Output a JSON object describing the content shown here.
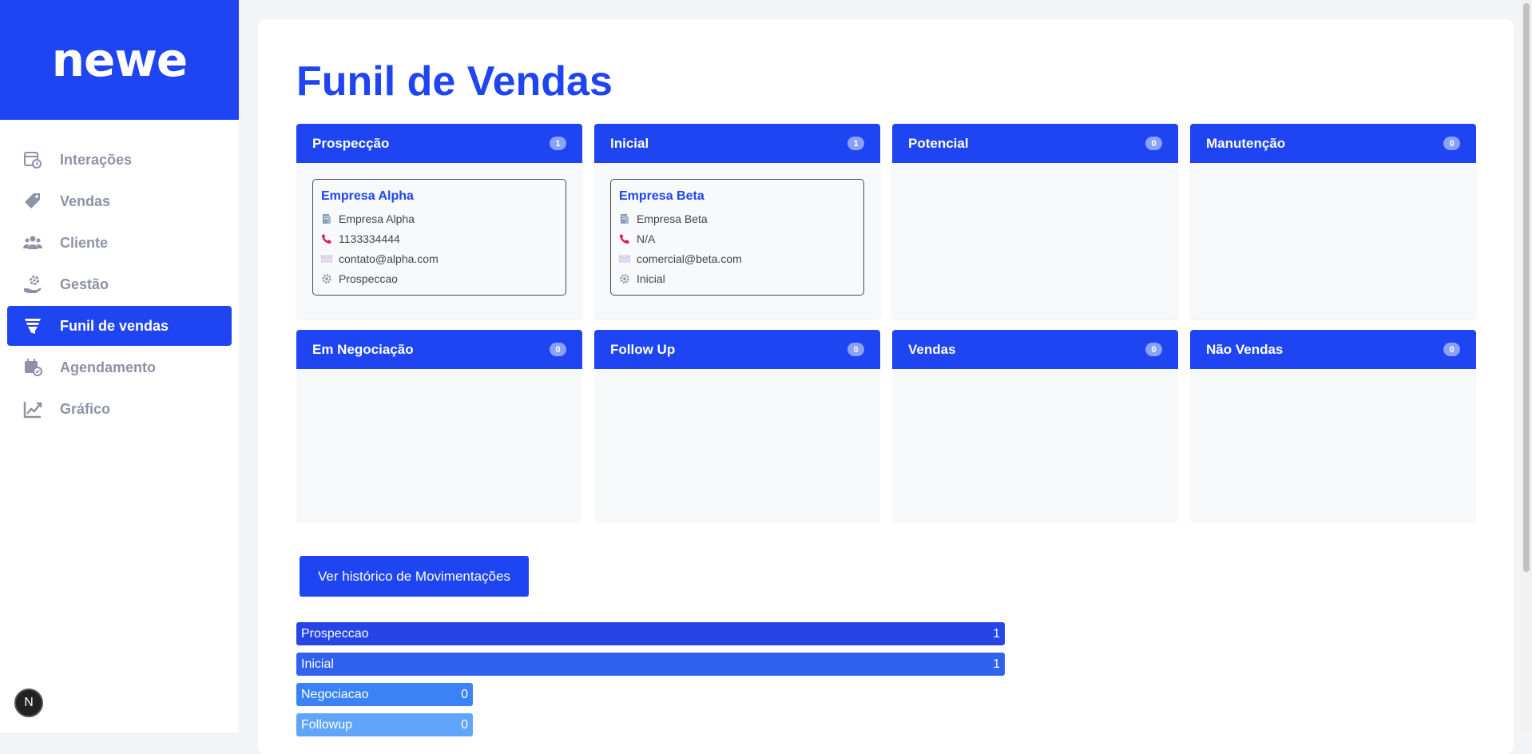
{
  "app": {
    "logo_text": "newe"
  },
  "sidebar": {
    "items": [
      {
        "label": "Interações",
        "icon": "calendar-clock-icon",
        "active": false
      },
      {
        "label": "Vendas",
        "icon": "tag-icon",
        "active": false
      },
      {
        "label": "Cliente",
        "icon": "users-icon",
        "active": false
      },
      {
        "label": "Gestão",
        "icon": "hand-gear-icon",
        "active": false
      },
      {
        "label": "Funil de vendas",
        "icon": "funnel-icon",
        "active": true
      },
      {
        "label": "Agendamento",
        "icon": "calendar-check-icon",
        "active": false
      },
      {
        "label": "Gráfico",
        "icon": "chart-line-icon",
        "active": false
      }
    ],
    "next_badge": "N"
  },
  "main": {
    "title": "Funil de Vendas",
    "columns": [
      {
        "title": "Prospecção",
        "count": "1",
        "cards": [
          {
            "name": "Empresa Alpha",
            "company": "Empresa Alpha",
            "phone": "1133334444",
            "email": "contato@alpha.com",
            "status": "Prospeccao"
          }
        ]
      },
      {
        "title": "Inicial",
        "count": "1",
        "cards": [
          {
            "name": "Empresa Beta",
            "company": "Empresa Beta",
            "phone": "N/A",
            "email": "comercial@beta.com",
            "status": "Inicial"
          }
        ]
      },
      {
        "title": "Potencial",
        "count": "0",
        "cards": []
      },
      {
        "title": "Manutenção",
        "count": "0",
        "cards": []
      },
      {
        "title": "Em Negociação",
        "count": "0",
        "cards": []
      },
      {
        "title": "Follow Up",
        "count": "0",
        "cards": []
      },
      {
        "title": "Vendas",
        "count": "0",
        "cards": []
      },
      {
        "title": "Não Vendas",
        "count": "0",
        "cards": []
      }
    ],
    "history_button": "Ver histórico de Movimentações",
    "stage_bars": [
      {
        "label": "Prospeccao",
        "value": "1",
        "color": "#2545e8"
      },
      {
        "label": "Inicial",
        "value": "1",
        "color": "#2f62ee"
      },
      {
        "label": "Negociacao",
        "value": "0",
        "color": "#3b82f6"
      },
      {
        "label": "Followup",
        "value": "0",
        "color": "#60a5fa"
      }
    ]
  },
  "colors": {
    "brand": "#1f45f2",
    "muted_nav": "#8d92a6",
    "column_bg": "#f7f8fa"
  }
}
